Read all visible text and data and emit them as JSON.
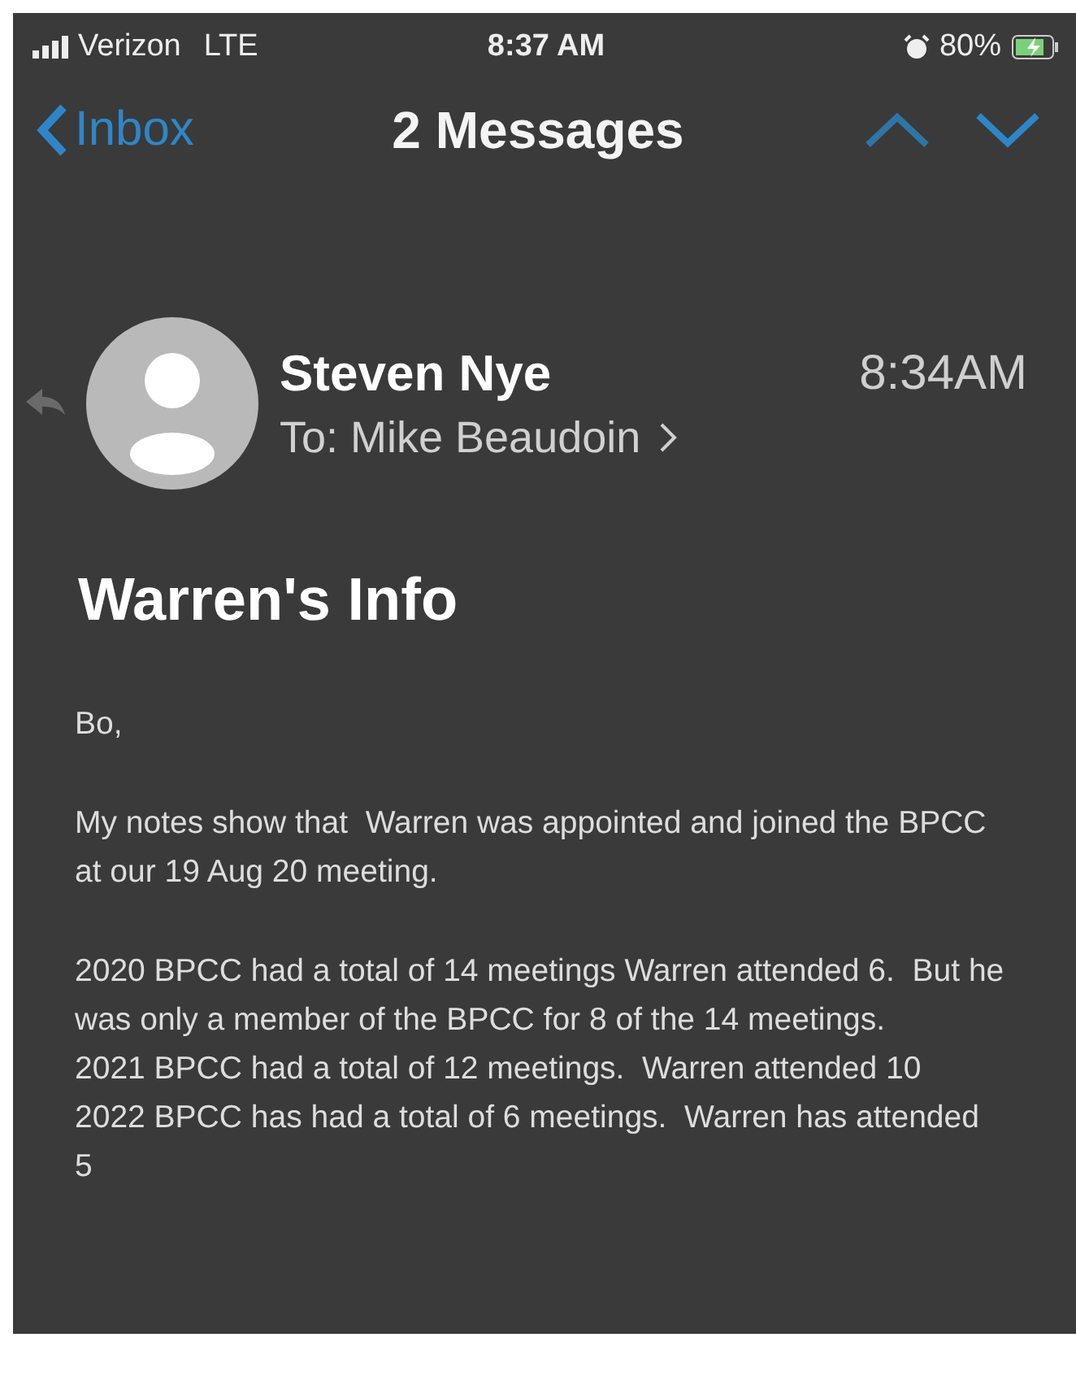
{
  "status_bar": {
    "carrier": "Verizon",
    "network": "LTE",
    "time": "8:37 AM",
    "battery": "80%"
  },
  "nav": {
    "back": "Inbox",
    "title": "2 Messages"
  },
  "message": {
    "sender": "Steven Nye",
    "time": "8:34AM",
    "recipient": "To: Mike Beaudoin",
    "subject": "Warren's Info",
    "body": [
      [
        "Bo,"
      ],
      [
        "My notes show that  Warren was appointed and joined the BPCC at our 19 Aug 20 meeting."
      ],
      [
        "2020 BPCC had a total of 14 meetings Warren attended 6.  But he was only a member of the BPCC for 8 of the 14 meetings.",
        "2021 BPCC had a total of 12 meetings.  Warren attended 10",
        "2022 BPCC has had a total of 6 meetings.  Warren has attended 5"
      ]
    ]
  }
}
